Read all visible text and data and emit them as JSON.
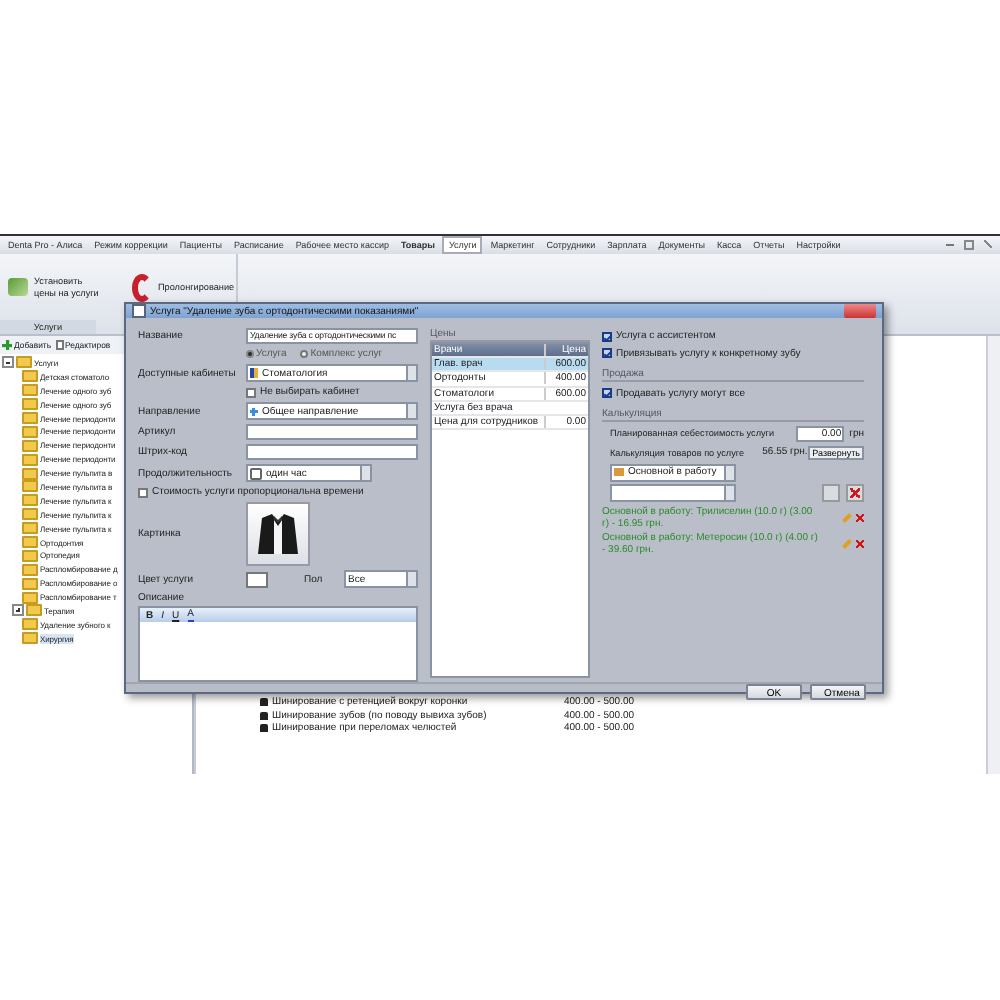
{
  "tabs": [
    {
      "label": "Denta Pro - Алиса",
      "selected": false,
      "bold": false
    },
    {
      "label": "Режим коррекции",
      "selected": false,
      "bold": false
    },
    {
      "label": "Пациенты",
      "selected": false,
      "bold": false
    },
    {
      "label": "Расписание",
      "selected": false,
      "bold": false
    },
    {
      "label": "Рабочее место кассир",
      "selected": false,
      "bold": false
    },
    {
      "label": "Товары",
      "selected": false,
      "bold": true
    },
    {
      "label": "Услуги",
      "selected": true,
      "bold": false
    },
    {
      "label": "Маркетинг",
      "selected": false,
      "bold": false
    },
    {
      "label": "Сотрудники",
      "selected": false,
      "bold": false
    },
    {
      "label": "Зарплата",
      "selected": false,
      "bold": false
    },
    {
      "label": "Документы",
      "selected": false,
      "bold": false
    },
    {
      "label": "Касса",
      "selected": false,
      "bold": false
    },
    {
      "label": "Отчеты",
      "selected": false,
      "bold": false
    },
    {
      "label": "Настройки",
      "selected": false,
      "bold": false
    }
  ],
  "ribbon": {
    "buttons": [
      {
        "label": "Установить цены на услуги",
        "kind": "prices"
      },
      {
        "label": "Пролонгирование",
        "kind": "prolong"
      }
    ],
    "group_label": "Услуги"
  },
  "left_toolbar": [
    "Добавить",
    "Редактиров"
  ],
  "tree": [
    {
      "label": "Услуги",
      "expanded": true,
      "selected": false,
      "children": [
        {
          "label": "Детская стоматоло",
          "selected": false
        },
        {
          "label": "Лечение одного зуб",
          "selected": false
        },
        {
          "label": "Лечение одного зуб",
          "selected": false
        },
        {
          "label": "Лечение периодонти",
          "selected": false
        },
        {
          "label": "Лечение периодонти",
          "selected": false
        },
        {
          "label": "Лечение периодонти",
          "selected": false
        },
        {
          "label": "Лечение периодонти",
          "selected": false
        },
        {
          "label": "Лечение пульпита в",
          "selected": false
        },
        {
          "label": "Лечение пульпита в",
          "selected": false
        },
        {
          "label": "Лечение пульпита к",
          "selected": false
        },
        {
          "label": "Лечение пульпита к",
          "selected": false
        },
        {
          "label": "Лечение пульпита к",
          "selected": false
        },
        {
          "label": "Ортодонтия",
          "selected": false
        },
        {
          "label": "Ортопедия",
          "selected": false
        },
        {
          "label": "Распломбирование д",
          "selected": false
        },
        {
          "label": "Распломбирование о",
          "selected": false
        },
        {
          "label": "Распломбирование т",
          "selected": false
        },
        {
          "label": "Терапия",
          "selected": false,
          "expanded": false
        },
        {
          "label": "Удаление зубного к",
          "selected": false
        },
        {
          "label": "Хирургия",
          "selected": true
        }
      ]
    }
  ],
  "list_rows": [
    {
      "name": "Шинирование с ретенцией вокруг коронки",
      "price": "400.00 - 500.00"
    },
    {
      "name": "Шинирование зубов (по поводу вывиха зубов)",
      "price": "400.00 - 500.00"
    },
    {
      "name": "Шинирование при переломах челюстей",
      "price": "400.00 - 500.00"
    }
  ],
  "dialog": {
    "title": "Услуга \"Удаление зуба с ортодонтическими показаниями\"",
    "fields": [
      {
        "kind": "text",
        "label": "Название",
        "value": "Удаление зуба с ортодонтическими пс"
      },
      {
        "kind": "radios",
        "options": [
          {
            "label": "Услуга",
            "selected": true
          },
          {
            "label": "Комплекс услуг",
            "selected": false
          }
        ]
      },
      {
        "kind": "select",
        "label": "Доступные кабинеты",
        "value": "Стоматология"
      },
      {
        "kind": "check",
        "label": "Не выбирать кабинет",
        "checked": false
      },
      {
        "kind": "select",
        "label": "Направление",
        "value": "Общее направление"
      },
      {
        "kind": "text",
        "label": "Артикул"
      },
      {
        "kind": "text",
        "label": "Штрих-код"
      },
      {
        "kind": "short",
        "label": "Продолжительность",
        "value": "один час"
      },
      {
        "kind": "check",
        "label": "Стоимость услуги пропорциональна времени",
        "checked": false
      },
      {
        "kind": "image",
        "label": "Картинка"
      },
      {
        "kind": "color",
        "label": "Цвет услуги",
        "extra_label": "Пол",
        "extra_value": "Все"
      },
      {
        "kind": "editor",
        "label": "Описание",
        "tools": [
          "B",
          "I",
          "U",
          "A"
        ]
      }
    ],
    "prices": {
      "title": "Цены",
      "columns": [
        "Врачи",
        "Цена"
      ],
      "rows": [
        {
          "doctor": "Глав. врач",
          "price": "600.00",
          "selected": true
        },
        {
          "doctor": "Ортодонты",
          "price": "400.00",
          "selected": false
        },
        {
          "doctor": "Стоматологи",
          "price": "600.00",
          "selected": false
        },
        {
          "doctor": "Услуга без врача",
          "price": "",
          "selected": false
        },
        {
          "doctor": "Цена для сотрудников",
          "price": "0.00",
          "selected": false
        }
      ]
    },
    "options": [
      {
        "label": "Услуга с ассистентом",
        "checked": true
      },
      {
        "label": "Привязывать услугу к конкретному зубу",
        "checked": true
      }
    ],
    "sale": {
      "title": "Продажа",
      "options": [
        {
          "label": "Продавать услугу могут все",
          "checked": true
        }
      ]
    },
    "calc": {
      "title": "Калькуляция",
      "cost_label": "Планированная себестоимость услуги",
      "cost_value": "0.00",
      "currency": "грн",
      "goods_label": "Калькуляция товаров по услуге",
      "goods_value": "56.55 грн.",
      "goods_button": "Развернуть",
      "select_value": "Основной в работу",
      "items": [
        "Основной в работу: Трилиселин (10.0 г) (3.00 г) - 16.95 грн.",
        "Основной в работу: Метеросин (10.0 г) (4.00 г) - 39.60 грн."
      ]
    },
    "buttons": [
      "OK",
      "Отмена"
    ]
  }
}
